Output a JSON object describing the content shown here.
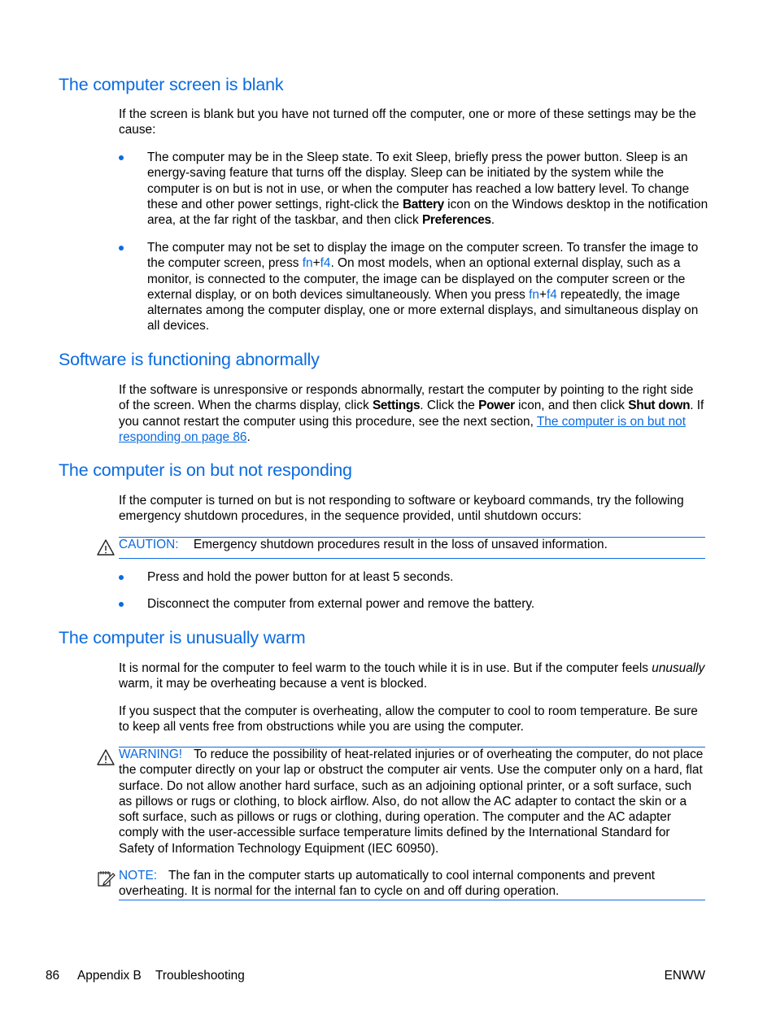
{
  "sections": [
    {
      "heading": "The computer screen is blank",
      "intro": "If the screen is blank but you have not turned off the computer, one or more of these settings may be the cause:",
      "bullets": [
        {
          "t1": "The computer may be in the Sleep state. To exit Sleep, briefly press the power button. Sleep is an energy-saving feature that turns off the display. Sleep can be initiated by the system while the computer is on but is not in use, or when the computer has reached a low battery level. To change these and other power settings, right-click the ",
          "b1": "Battery",
          "t2": " icon on the Windows desktop in the notification area, at the far right of the taskbar, and then click ",
          "b2": "Preferences",
          "t3": "."
        },
        {
          "t1": "The computer may not be set to display the image on the computer screen. To transfer the image to the computer screen, press ",
          "k1": "fn",
          "plus1": "+",
          "k2": "f4",
          "t2": ". On most models, when an optional external display, such as a monitor, is connected to the computer, the image can be displayed on the computer screen or the external display, or on both devices simultaneously. When you press ",
          "k3": "fn",
          "plus2": "+",
          "k4": "f4",
          "t3": " repeatedly, the image alternates among the computer display, one or more external displays, and simultaneous display on all devices."
        }
      ]
    },
    {
      "heading": "Software is functioning abnormally",
      "p1": "If the software is unresponsive or responds abnormally, restart the computer by pointing to the right side of the screen. When the charms display, click ",
      "b1": "Settings",
      "p2": ". Click the ",
      "b2": "Power",
      "p3": " icon, and then click ",
      "b3": "Shut down",
      "p4": ". If you cannot restart the computer using this procedure, see the next section, ",
      "link": "The computer is on but not responding on page 86",
      "p5": "."
    },
    {
      "heading": "The computer is on but not responding",
      "intro": "If the computer is turned on but is not responding to software or keyboard commands, try the following emergency shutdown procedures, in the sequence provided, until shutdown occurs:",
      "caution_label": "CAUTION:",
      "caution_text": "Emergency shutdown procedures result in the loss of unsaved information.",
      "bullets": [
        "Press and hold the power button for at least 5 seconds.",
        "Disconnect the computer from external power and remove the battery."
      ]
    },
    {
      "heading": "The computer is unusually warm",
      "p1a": "It is normal for the computer to feel warm to the touch while it is in use. But if the computer feels ",
      "p1i": "unusually",
      "p1b": " warm, it may be overheating because a vent is blocked.",
      "p2": "If you suspect that the computer is overheating, allow the computer to cool to room temperature. Be sure to keep all vents free from obstructions while you are using the computer.",
      "warning_label": "WARNING!",
      "warning_text": "To reduce the possibility of heat-related injuries or of overheating the computer, do not place the computer directly on your lap or obstruct the computer air vents. Use the computer only on a hard, flat surface. Do not allow another hard surface, such as an adjoining optional printer, or a soft surface, such as pillows or rugs or clothing, to block airflow. Also, do not allow the AC adapter to contact the skin or a soft surface, such as pillows or rugs or clothing, during operation. The computer and the AC adapter comply with the user-accessible surface temperature limits defined by the International Standard for Safety of Information Technology Equipment (IEC 60950).",
      "note_label": "NOTE:",
      "note_text": "The fan in the computer starts up automatically to cool internal components and prevent overheating. It is normal for the internal fan to cycle on and off during operation."
    }
  ],
  "footer": {
    "page_number": "86",
    "chapter": "Appendix B",
    "chapter_title": "Troubleshooting",
    "locale": "ENWW"
  },
  "colors": {
    "accent": "#0a6be0",
    "text": "#000000"
  },
  "icons": {
    "caution": "warning-triangle-icon",
    "warning": "warning-triangle-icon",
    "note": "note-pencil-icon"
  }
}
